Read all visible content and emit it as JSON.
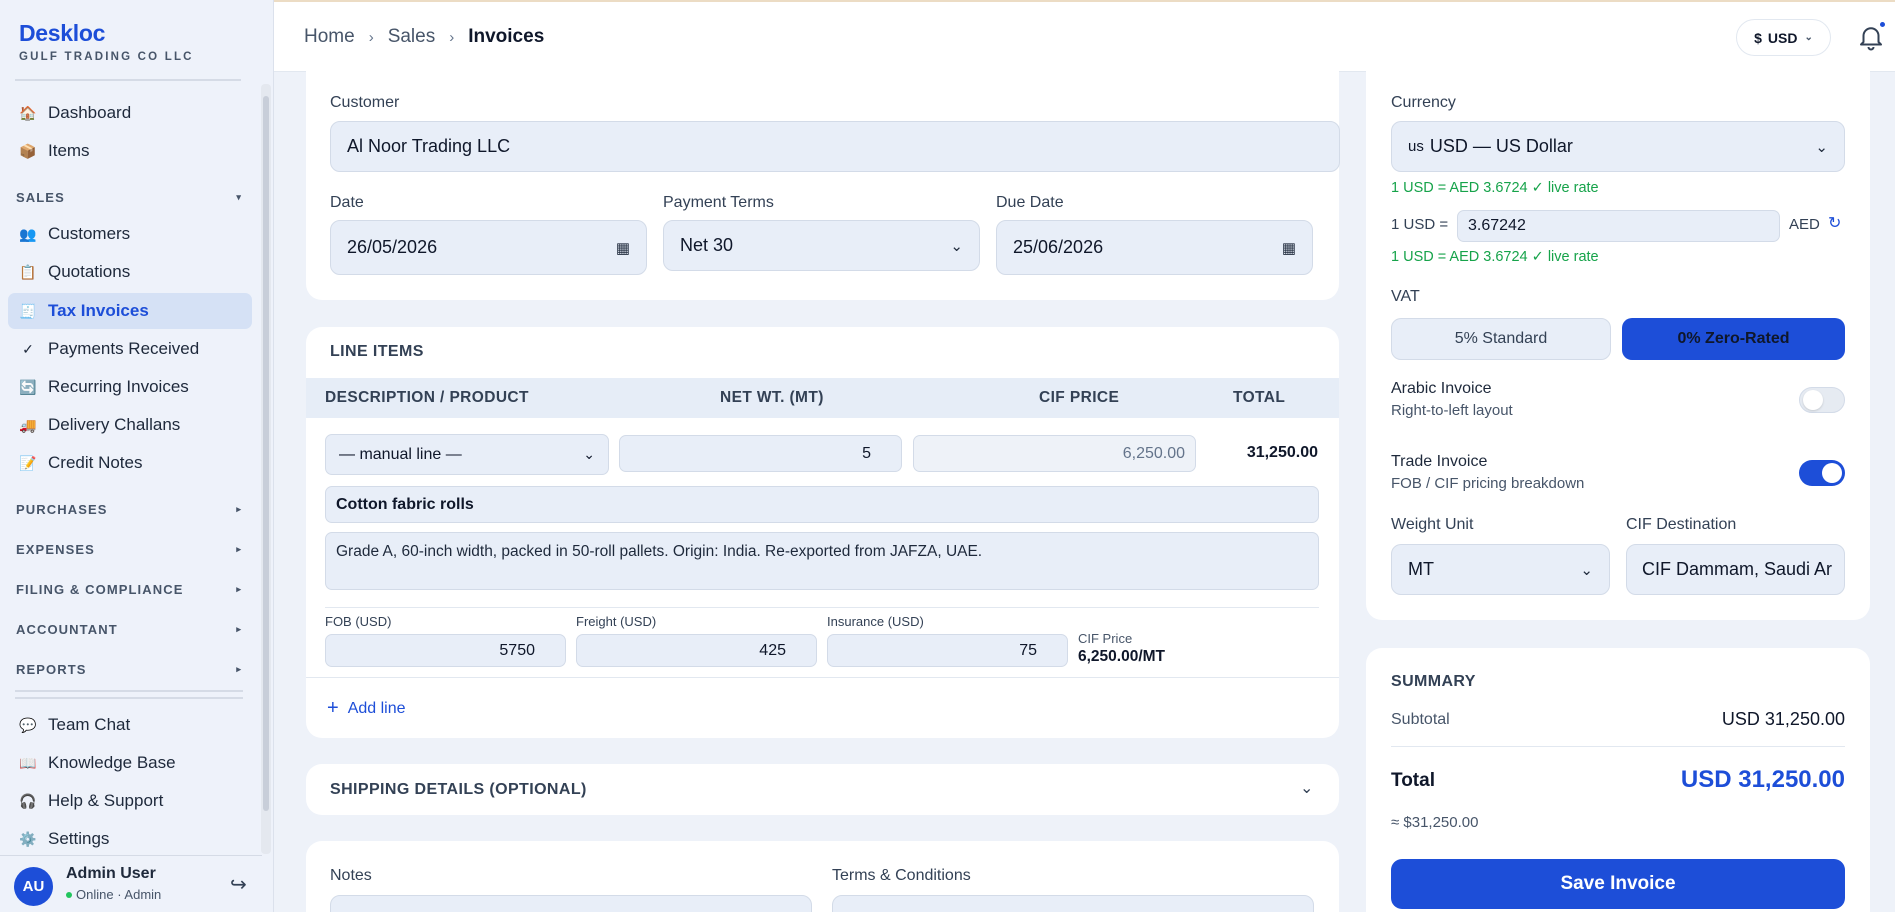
{
  "brand": {
    "name": "Deskloc",
    "sub": "GULF TRADING CO LLC"
  },
  "sidebar": {
    "top_items": [
      {
        "label": "Dashboard",
        "icon": "🏠"
      },
      {
        "label": "Items",
        "icon": "📦"
      }
    ],
    "sales_header": "SALES",
    "sales_items": [
      {
        "label": "Customers",
        "icon": "👥"
      },
      {
        "label": "Quotations",
        "icon": "📋"
      },
      {
        "label": "Tax Invoices",
        "icon": "🧾"
      },
      {
        "label": "Payments Received",
        "icon": "✓"
      },
      {
        "label": "Recurring Invoices",
        "icon": "🔄"
      },
      {
        "label": "Delivery Challans",
        "icon": "🚚"
      },
      {
        "label": "Credit Notes",
        "icon": "📝"
      }
    ],
    "sections": [
      "PURCHASES",
      "EXPENSES",
      "FILING & COMPLIANCE",
      "ACCOUNTANT",
      "REPORTS"
    ],
    "bottom_items": [
      {
        "label": "Team Chat",
        "icon": "💬"
      },
      {
        "label": "Knowledge Base",
        "icon": "📖"
      },
      {
        "label": "Help & Support",
        "icon": "🎧"
      },
      {
        "label": "Settings",
        "icon": "⚙️"
      }
    ],
    "user": {
      "initials": "AU",
      "name": "Admin User",
      "status": "Online · Admin"
    }
  },
  "header": {
    "breadcrumb": [
      "Home",
      "Sales",
      "Invoices"
    ],
    "currency_pill": {
      "symbol": "$",
      "code": "USD"
    }
  },
  "invoice": {
    "customer_label": "Customer",
    "customer": "Al Noor Trading LLC",
    "date_label": "Date",
    "date": "26/05/2026",
    "terms_label": "Payment Terms",
    "terms": "Net 30",
    "due_label": "Due Date",
    "due": "25/06/2026"
  },
  "line_items": {
    "title": "LINE ITEMS",
    "columns": [
      "DESCRIPTION / PRODUCT",
      "NET WT. (MT)",
      "CIF PRICE",
      "TOTAL"
    ],
    "product_select": "— manual line —",
    "net_wt": "5",
    "cif_price": "6,250.00",
    "total": "31,250.00",
    "item_name": "Cotton fabric rolls",
    "item_desc": "Grade A, 60-inch width, packed in 50-roll pallets. Origin: India. Re-exported from JAFZA, UAE.",
    "fob_label": "FOB (USD)",
    "fob": "5750",
    "freight_label": "Freight (USD)",
    "freight": "425",
    "insurance_label": "Insurance (USD)",
    "insurance": "75",
    "cif_label": "CIF Price",
    "cif_value": "6,250.00/MT",
    "add_line": "Add line"
  },
  "shipping": {
    "title": "SHIPPING DETAILS (OPTIONAL)"
  },
  "notes": {
    "notes_label": "Notes",
    "terms_label": "Terms & Conditions"
  },
  "settings_panel": {
    "currency_label": "Currency",
    "currency_flag": "us",
    "currency_value": "USD — US Dollar",
    "live_rate": "1 USD = AED 3.6724 ✓ live rate",
    "rate_prefix": "1 USD =",
    "rate_value": "3.67242",
    "rate_suffix": "AED",
    "live_rate_2": "1 USD = AED 3.6724 ✓ live rate",
    "vat_label": "VAT",
    "vat_options": [
      "5% Standard",
      "0% Zero-Rated"
    ],
    "vat_selected": "0% Zero-Rated",
    "arabic_title": "Arabic Invoice",
    "arabic_sub": "Right-to-left layout",
    "arabic_on": false,
    "trade_title": "Trade Invoice",
    "trade_sub": "FOB / CIF pricing breakdown",
    "trade_on": true,
    "weight_label": "Weight Unit",
    "weight_value": "MT",
    "cif_dest_label": "CIF Destination",
    "cif_dest_value": "CIF Dammam, Saudi Ar"
  },
  "summary": {
    "title": "SUMMARY",
    "subtotal_label": "Subtotal",
    "subtotal": "USD 31,250.00",
    "total_label": "Total",
    "total": "USD 31,250.00",
    "approx": "≈ $31,250.00",
    "save_label": "Save Invoice"
  },
  "colors": {
    "accent": "#1d4ed8",
    "green": "#16a34a",
    "bg": "#eef2f9"
  }
}
